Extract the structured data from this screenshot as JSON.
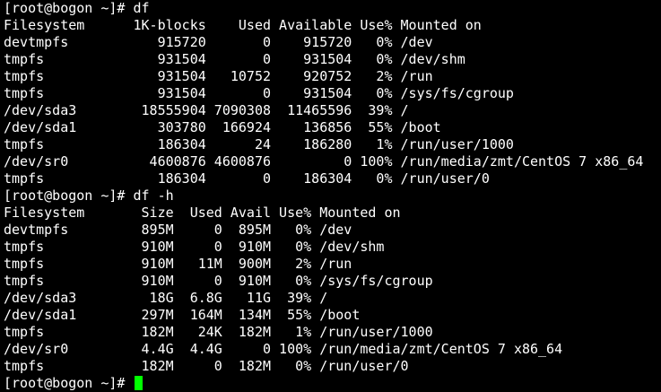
{
  "terminal": {
    "cursor_color": "#00ff00",
    "text_color": "#ffffff",
    "background_color": "#000000",
    "lines": [
      "[root@bogon ~]# df",
      "Filesystem      1K-blocks    Used Available Use% Mounted on",
      "devtmpfs           915720       0    915720   0% /dev",
      "tmpfs              931504       0    931504   0% /dev/shm",
      "tmpfs              931504   10752    920752   2% /run",
      "tmpfs              931504       0    931504   0% /sys/fs/cgroup",
      "/dev/sda3        18555904 7090308  11465596  39% /",
      "/dev/sda1          303780  166924    136856  55% /boot",
      "tmpfs              186304      24    186280   1% /run/user/1000",
      "/dev/sr0          4600876 4600876         0 100% /run/media/zmt/CentOS 7 x86_64",
      "tmpfs              186304       0    186304   0% /run/user/0",
      "[root@bogon ~]# df -h",
      "Filesystem       Size  Used Avail Use% Mounted on",
      "devtmpfs         895M     0  895M   0% /dev",
      "tmpfs            910M     0  910M   0% /dev/shm",
      "tmpfs            910M   11M  900M   2% /run",
      "tmpfs            910M     0  910M   0% /sys/fs/cgroup",
      "/dev/sda3         18G  6.8G   11G  39% /",
      "/dev/sda1        297M  164M  134M  55% /boot",
      "tmpfs            182M   24K  182M   1% /run/user/1000",
      "/dev/sr0         4.4G  4.4G     0 100% /run/media/zmt/CentOS 7 x86_64",
      "tmpfs            182M     0  182M   0% /run/user/0"
    ],
    "prompt": "[root@bogon ~]# "
  }
}
